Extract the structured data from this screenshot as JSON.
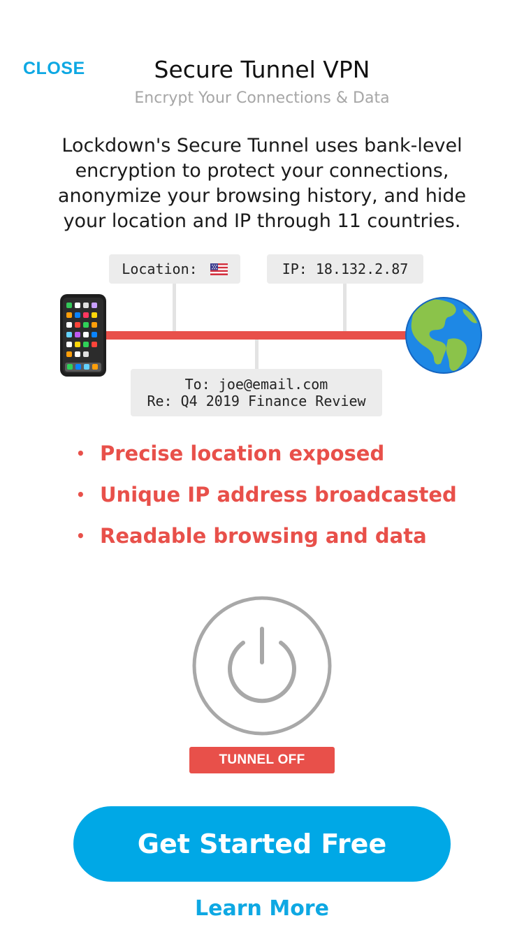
{
  "header": {
    "close_label": "CLOSE",
    "title": "Secure Tunnel VPN",
    "subtitle": "Encrypt Your Connections & Data"
  },
  "description": "Lockdown's Secure Tunnel uses bank-level encryption to protect your connections, anonymize your browsing history, and hide your location and IP through 11 countries.",
  "diagram": {
    "location_label": "Location:",
    "location_flag": "US flag",
    "ip_label": "IP: 18.132.2.87",
    "email_to": "To: joe@email.com",
    "email_re": "Re: Q4 2019 Finance Review",
    "left_icon": "phone-icon",
    "right_icon": "globe-icon",
    "line_color": "#e8504a"
  },
  "risks": [
    "Precise location exposed",
    "Unique IP address broadcasted",
    "Readable browsing and data"
  ],
  "tunnel": {
    "status_label": "TUNNEL OFF",
    "status_color": "#e8504a",
    "power_icon": "power-icon"
  },
  "cta": {
    "primary_label": "Get Started Free",
    "secondary_label": "Learn More",
    "accent_color": "#00a8e6"
  }
}
